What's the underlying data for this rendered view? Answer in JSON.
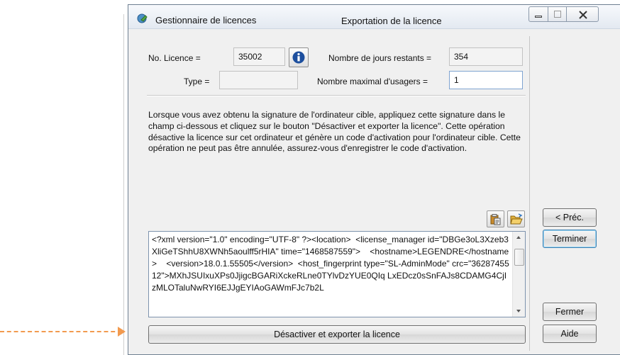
{
  "window": {
    "app_title": "Gestionnaire de licences",
    "doc_title": "Exportation de la licence"
  },
  "form": {
    "license_label": "No. Licence =",
    "license_value": "35002",
    "type_label": "Type =",
    "type_value": "",
    "days_label": "Nombre de jours restants =",
    "days_value": "354",
    "users_label": "Nombre maximal d'usagers =",
    "users_value": "1"
  },
  "description": "Lorsque vous avez obtenu la signature de l'ordinateur cible, appliquez cette signature dans le champ ci-dessous et cliquez sur le bouton \"Désactiver et exporter la licence\". Cette opération désactive la licence sur cet ordinateur et génère un code d'activation pour l'ordinateur cible. Cette opération ne peut pas être annulée, assurez-vous d'enregistrer le code d'activation.",
  "signature_text": "<?xml version=\"1.0\" encoding=\"UTF-8\" ?><location>  <license_manager id=\"DBGe3oL3Xzeb3XliGeTShhU8XWNh5aoulff5rHIA\" time=\"1468587559\">    <hostname>LEGENDRE</hostname>    <version>18.0.1.55505</version>  <host_fingerprint type=\"SL-AdminMode\" crc=\"3628745512\">MXhJSUIxuXPs0JjigcBGARiXckeRLne0TYlvDzYUE0QIq LxEDcz0sSnFAJs8CDAMG4CjIzMLOTaluNwRYI6EJJgEYIAoGAWmFJc7b2L",
  "buttons": {
    "deactivate": "Désactiver et exporter la licence",
    "previous": "< Préc.",
    "finish": "Terminer",
    "close": "Fermer",
    "help": "Aide"
  },
  "icons": {
    "app": "license-manager-icon",
    "info": "info-icon",
    "paste": "clipboard-paste-icon",
    "open": "open-folder-icon"
  },
  "colors": {
    "info_blue": "#1d4f9e",
    "annotation_arrow": "#f29a4f"
  }
}
